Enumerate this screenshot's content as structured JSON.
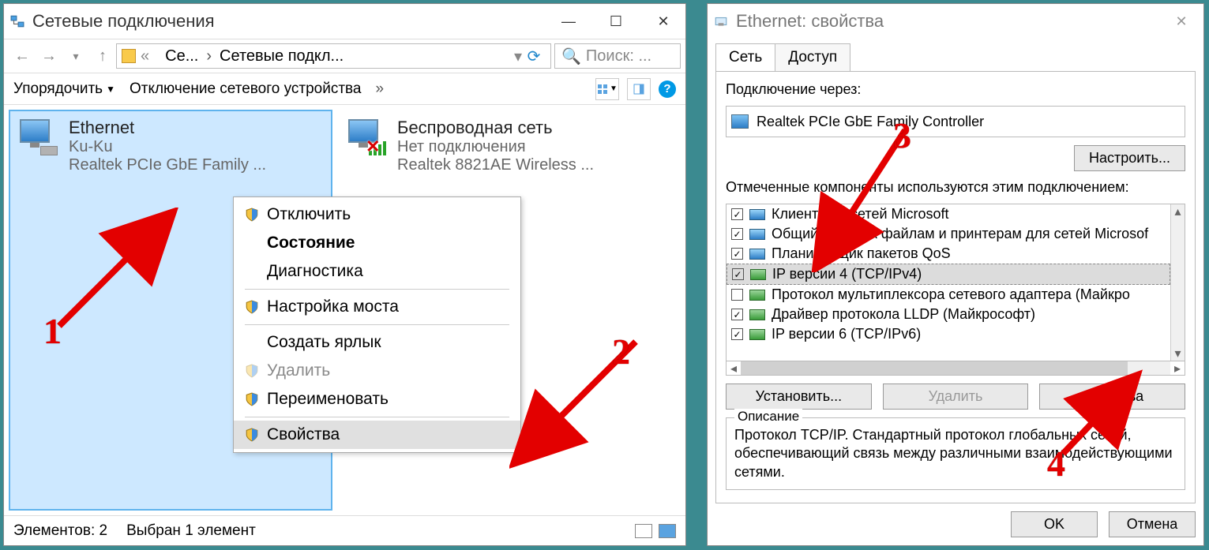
{
  "left": {
    "title": "Сетевые подключения",
    "nav": {
      "crumb1": "Се...",
      "crumb2": "Сетевые подкл...",
      "search_placeholder": "Поиск: ..."
    },
    "toolbar": {
      "sort": "Упорядочить",
      "disable": "Отключение сетевого устройства",
      "more": "»"
    },
    "adapters": {
      "ethernet": {
        "name": "Ethernet",
        "status": "Ku-Ku",
        "device": "Realtek PCIe GbE Family ..."
      },
      "wifi": {
        "name": "Беспроводная сеть",
        "status": "Нет подключения",
        "device": "Realtek 8821AE Wireless ..."
      }
    },
    "ctx": {
      "disable": "Отключить",
      "status": "Состояние",
      "diag": "Диагностика",
      "bridge": "Настройка моста",
      "shortcut": "Создать ярлык",
      "delete": "Удалить",
      "rename": "Переименовать",
      "properties": "Свойства"
    },
    "status": {
      "count": "Элементов: 2",
      "selected": "Выбран 1 элемент"
    }
  },
  "right": {
    "title": "Ethernet: свойства",
    "tabs": {
      "net": "Сеть",
      "access": "Доступ"
    },
    "via_label": "Подключение через:",
    "via_value": "Realtek PCIe GbE Family Controller",
    "configure": "Настроить...",
    "components_label": "Отмеченные компоненты используются этим подключением:",
    "components": [
      {
        "checked": true,
        "label": "Клиент для сетей Microsoft",
        "blue": true
      },
      {
        "checked": true,
        "label": "Общий доступ к файлам и принтерам для сетей Microsof",
        "blue": true
      },
      {
        "checked": true,
        "label": "Планировщик пакетов QoS",
        "blue": true
      },
      {
        "checked": true,
        "label": "IP версии 4 (TCP/IPv4)",
        "hl": true
      },
      {
        "checked": false,
        "label": "Протокол мультиплексора сетевого адаптера (Майкро"
      },
      {
        "checked": true,
        "label": "Драйвер протокола LLDP (Майкрософт)"
      },
      {
        "checked": true,
        "label": "IP версии 6 (TCP/IPv6)"
      }
    ],
    "install": "Установить...",
    "remove": "Удалить",
    "props": "Свойства",
    "desc_legend": "Описание",
    "desc_text": "Протокол TCP/IP. Стандартный протокол глобальных сетей, обеспечивающий связь между различными взаимодействующими сетями.",
    "ok": "OK",
    "cancel": "Отмена"
  },
  "annotations": {
    "one": "1",
    "two": "2",
    "three": "3",
    "four": "4"
  }
}
